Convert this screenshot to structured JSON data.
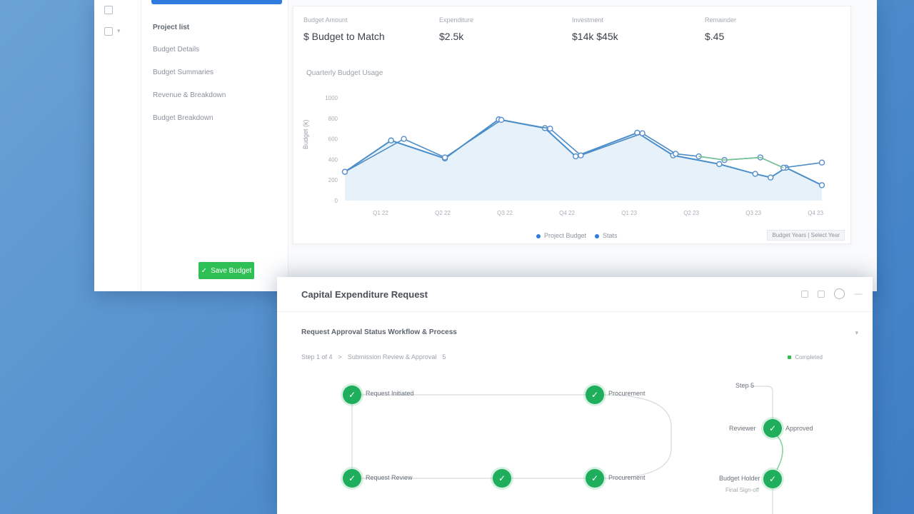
{
  "app": {
    "sidebar": {
      "heading": "Project list",
      "items": [
        {
          "label": "Budget Details"
        },
        {
          "label": "Budget Summaries"
        },
        {
          "label": "Revenue & Breakdown"
        },
        {
          "label": "Budget Breakdown"
        }
      ],
      "action_button": {
        "icon": "check-icon",
        "label": "Save Budget"
      }
    },
    "stats": [
      {
        "label": "Budget Amount",
        "value": "$ Budget to Match"
      },
      {
        "label": "Expenditure",
        "value": "$2.5k"
      },
      {
        "label": "Investment",
        "value": "$14k $45k"
      },
      {
        "label": "Remainder",
        "value": "$.45"
      }
    ],
    "chart_legend_footer": "Budget Years | Select Year"
  },
  "chart_data": {
    "type": "line",
    "title": "Quarterly Budget Usage",
    "ylabel": "Budget (k)",
    "xlabel": "",
    "categories": [
      "Q1 22",
      "Q2 22",
      "Q3 22",
      "Q4 22",
      "Q1 23",
      "Q2 23",
      "Q3 23",
      "Q4 23"
    ],
    "yticks": [
      "0",
      "200",
      "400",
      "600",
      "800",
      "1000"
    ],
    "ylim": [
      0,
      1000
    ],
    "grid": false,
    "legend": "bottom-center",
    "series": [
      {
        "name": "Project Budget",
        "color": "#4d8fc9",
        "points": [
          [
            0,
            280
          ],
          [
            0.9,
            585
          ],
          [
            1.95,
            410
          ],
          [
            3.0,
            790
          ],
          [
            3.9,
            705
          ],
          [
            4.5,
            430
          ],
          [
            5.7,
            660
          ],
          [
            6.4,
            440
          ],
          [
            7.3,
            355
          ],
          [
            8.0,
            260
          ],
          [
            8.3,
            225
          ],
          [
            8.6,
            320
          ],
          [
            9.3,
            150
          ]
        ]
      },
      {
        "name": "Stats",
        "color": "#5b8ccf",
        "points": [
          [
            0,
            280
          ],
          [
            1.15,
            600
          ],
          [
            1.95,
            420
          ],
          [
            3.05,
            785
          ],
          [
            4.0,
            700
          ],
          [
            4.6,
            440
          ],
          [
            5.8,
            655
          ],
          [
            6.45,
            455
          ],
          [
            6.9,
            430
          ],
          [
            7.4,
            395
          ],
          [
            8.1,
            420
          ],
          [
            8.55,
            320
          ],
          [
            9.3,
            370
          ]
        ]
      }
    ]
  },
  "dialog": {
    "title": "Capital Expenditure Request",
    "panel_heading": "Request Approval Status Workflow & Process",
    "breadcrumb": [
      "Step 1 of 4",
      ">",
      "Submission Review & Approval",
      "5"
    ],
    "legend_label": "Completed",
    "controls": {
      "minimize": "square-icon",
      "restore": "square-icon",
      "help": "circle-icon",
      "more": "more-icon"
    },
    "collapse": "▾",
    "flow_left": [
      {
        "label": "Request Initiated",
        "icon": "check-icon"
      },
      {
        "label": "Procurement",
        "icon": "check-icon"
      },
      {
        "label": "Request Review",
        "icon": "check-icon"
      },
      {
        "label": "",
        "icon": "check-icon"
      },
      {
        "label": "Procurement",
        "icon": "check-icon"
      }
    ],
    "flow_right": {
      "top_label": "Step 5",
      "nodes": [
        {
          "left_label": "Reviewer",
          "right_label": "Approved",
          "icon": "check-icon"
        },
        {
          "left_label": "Budget Holder",
          "sub_label": "Final Sign-off",
          "icon": "check-icon"
        }
      ]
    }
  }
}
